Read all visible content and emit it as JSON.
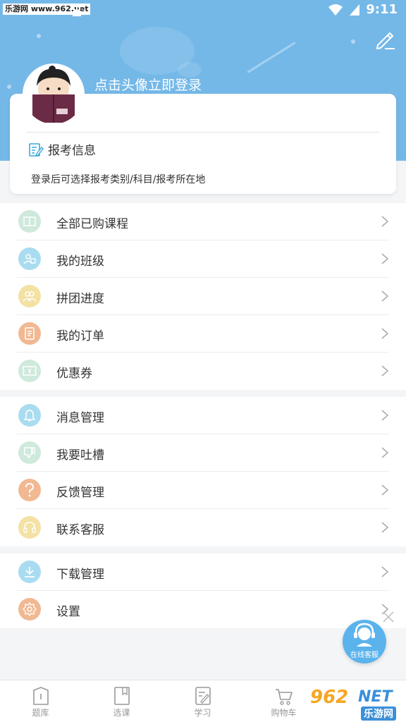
{
  "status_bar": {
    "watermark": "乐游网 www.962.net",
    "time": "9:11"
  },
  "profile": {
    "login_prompt": "点击头像立即登录"
  },
  "exam_info": {
    "title": "报考信息",
    "subtitle": "登录后可选择报考类别/科目/报考所在地"
  },
  "menu_groups": [
    {
      "items": [
        {
          "label": "全部已购课程",
          "icon": "book-icon",
          "color": "#cfe9dc"
        },
        {
          "label": "我的班级",
          "icon": "class-icon",
          "color": "#a9dcf0"
        },
        {
          "label": "拼团进度",
          "icon": "group-icon",
          "color": "#f3e2a3"
        },
        {
          "label": "我的订单",
          "icon": "order-icon",
          "color": "#f1b892"
        },
        {
          "label": "优惠券",
          "icon": "coupon-icon",
          "color": "#cfe9dc"
        }
      ]
    },
    {
      "items": [
        {
          "label": "消息管理",
          "icon": "bell-icon",
          "color": "#a9dcf0"
        },
        {
          "label": "我要吐槽",
          "icon": "thumbs-down-icon",
          "color": "#cfe9dc"
        },
        {
          "label": "反馈管理",
          "icon": "question-icon",
          "color": "#f1b892"
        },
        {
          "label": "联系客服",
          "icon": "headset-icon",
          "color": "#f3e2a3"
        }
      ]
    },
    {
      "items": [
        {
          "label": "下载管理",
          "icon": "download-icon",
          "color": "#a9dcf0"
        },
        {
          "label": "设置",
          "icon": "gear-icon",
          "color": "#f1b892"
        }
      ]
    }
  ],
  "float_service": {
    "label": "在线客服"
  },
  "bottom_nav": {
    "tabs": [
      {
        "label": "题库",
        "icon": "question-bank-icon"
      },
      {
        "label": "选课",
        "icon": "course-icon"
      },
      {
        "label": "学习",
        "icon": "study-icon"
      },
      {
        "label": "购物车",
        "icon": "cart-icon"
      }
    ]
  },
  "watermark_bottom": {
    "brand": "962",
    "suffix": "NET",
    "site": "乐游网"
  },
  "colors": {
    "header": "#74b8e8",
    "accent": "#5bb3ec"
  }
}
